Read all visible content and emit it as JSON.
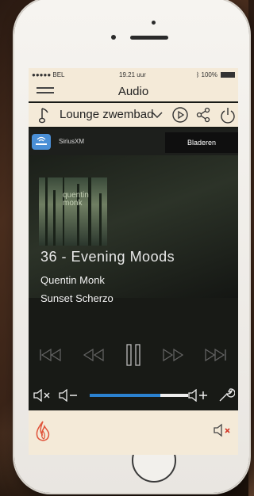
{
  "status": {
    "carrier": "●●●●● BEL",
    "time": "19.21 uur",
    "battery": "100%"
  },
  "header": {
    "title": "Audio"
  },
  "zone": {
    "name": "Lounge zwembad"
  },
  "source": {
    "name": "SiriusXM",
    "browse_label": "Bladeren"
  },
  "album_art_text": {
    "line1": "quentin",
    "line2": "monk"
  },
  "now_playing": {
    "title": "36 - Evening Moods",
    "artist": "Quentin Monk",
    "album": "Sunset Scherzo"
  },
  "volume": {
    "level": 0.72
  },
  "colors": {
    "accent": "#2b82d0",
    "header_bg": "#f4ead8",
    "flame": "#e0533a"
  },
  "icons": {
    "menu": "hamburger-icon",
    "music": "music-note-icon",
    "dropdown": "chevron-down-icon",
    "play_circle": "play-circle-icon",
    "share": "share-icon",
    "power": "power-icon",
    "settings": "wrench-icon",
    "flame": "flame-icon",
    "mute": "speaker-mute-icon"
  }
}
